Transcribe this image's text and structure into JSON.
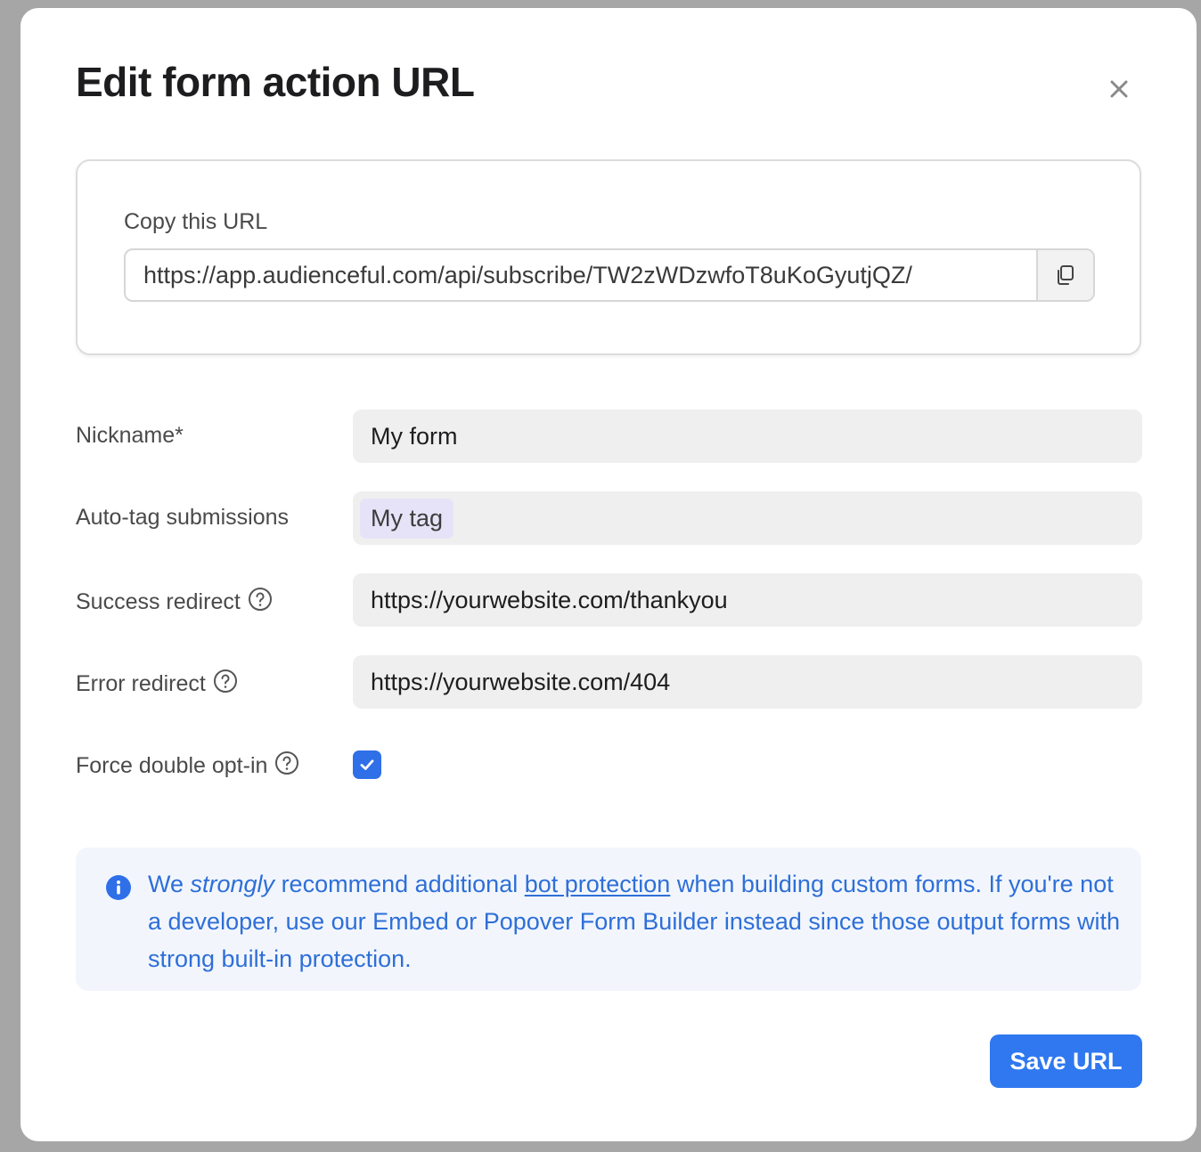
{
  "modal": {
    "title": "Edit form action URL",
    "close_icon": "close-icon"
  },
  "copy_section": {
    "label": "Copy this URL",
    "url": "https://app.audienceful.com/api/subscribe/TW2zWDzwfoT8uKoGyutjQZ/",
    "copy_icon": "copy-icon"
  },
  "form": {
    "nickname": {
      "label": "Nickname*",
      "value": "My form"
    },
    "auto_tag": {
      "label": "Auto-tag submissions",
      "tags": [
        "My tag"
      ]
    },
    "success_redirect": {
      "label": "Success redirect",
      "value": "https://yourwebsite.com/thankyou",
      "help_icon": "help-icon"
    },
    "error_redirect": {
      "label": "Error redirect",
      "value": "https://yourwebsite.com/404",
      "help_icon": "help-icon"
    },
    "force_double_optin": {
      "label": "Force double opt-in",
      "checked": true,
      "help_icon": "help-icon"
    }
  },
  "notice": {
    "icon": "info-icon",
    "text_1": "We ",
    "text_emphasis": "strongly",
    "text_2": " recommend additional ",
    "link_text": "bot protection",
    "text_3": " when building custom forms. If you're not a developer, use our Embed or Popover Form Builder instead since those output forms with strong built-in protection."
  },
  "footer": {
    "save_label": "Save URL"
  },
  "colors": {
    "accent": "#2f78f0",
    "checkbox": "#2f6fe8",
    "notice_text": "#2e6fd8",
    "notice_bg": "#f2f6fc",
    "tag_bg": "#e6e3f8",
    "field_bg": "#efefef"
  }
}
